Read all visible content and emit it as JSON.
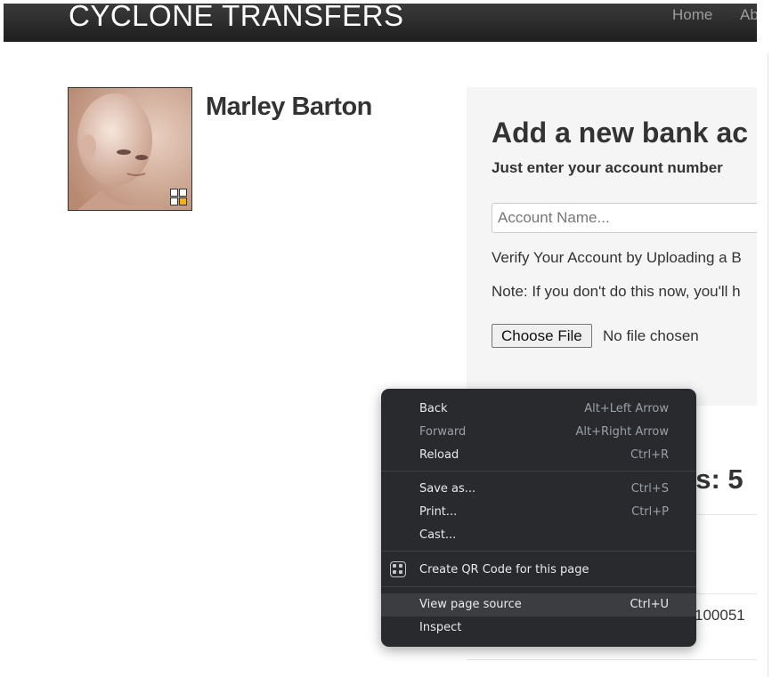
{
  "navbar": {
    "brand": "CYCLONE TRANSFERS",
    "links": [
      "Home",
      "Ab"
    ]
  },
  "profile": {
    "name": "Marley Barton"
  },
  "panel": {
    "title": "Add a new bank ac",
    "subtitle": "Just enter your account number",
    "account_name_placeholder": "Account Name...",
    "verify_text": "Verify Your Account by Uploading a B",
    "note_text": "Note: If you don't do this now, you'll h",
    "file_button": "Choose File",
    "file_status": "No file chosen"
  },
  "accounts": {
    "heading": "nts: 5",
    "row_number": "100051"
  },
  "context_menu": {
    "items": [
      {
        "label": "Back",
        "shortcut": "Alt+Left Arrow"
      },
      {
        "label": "Forward",
        "shortcut": "Alt+Right Arrow"
      },
      {
        "label": "Reload",
        "shortcut": "Ctrl+R"
      },
      {
        "label": "Save as...",
        "shortcut": "Ctrl+S"
      },
      {
        "label": "Print...",
        "shortcut": "Ctrl+P"
      },
      {
        "label": "Cast...",
        "shortcut": ""
      },
      {
        "label": "Create QR Code for this page",
        "shortcut": "",
        "icon": "qr-code-icon"
      },
      {
        "label": "View page source",
        "shortcut": "Ctrl+U"
      },
      {
        "label": "Inspect",
        "shortcut": ""
      }
    ]
  },
  "colors": {
    "navbar": "#222222",
    "menu_bg": "#292a2d",
    "menu_hover": "#3c3d41",
    "panel_bg": "#f5f5f5"
  }
}
